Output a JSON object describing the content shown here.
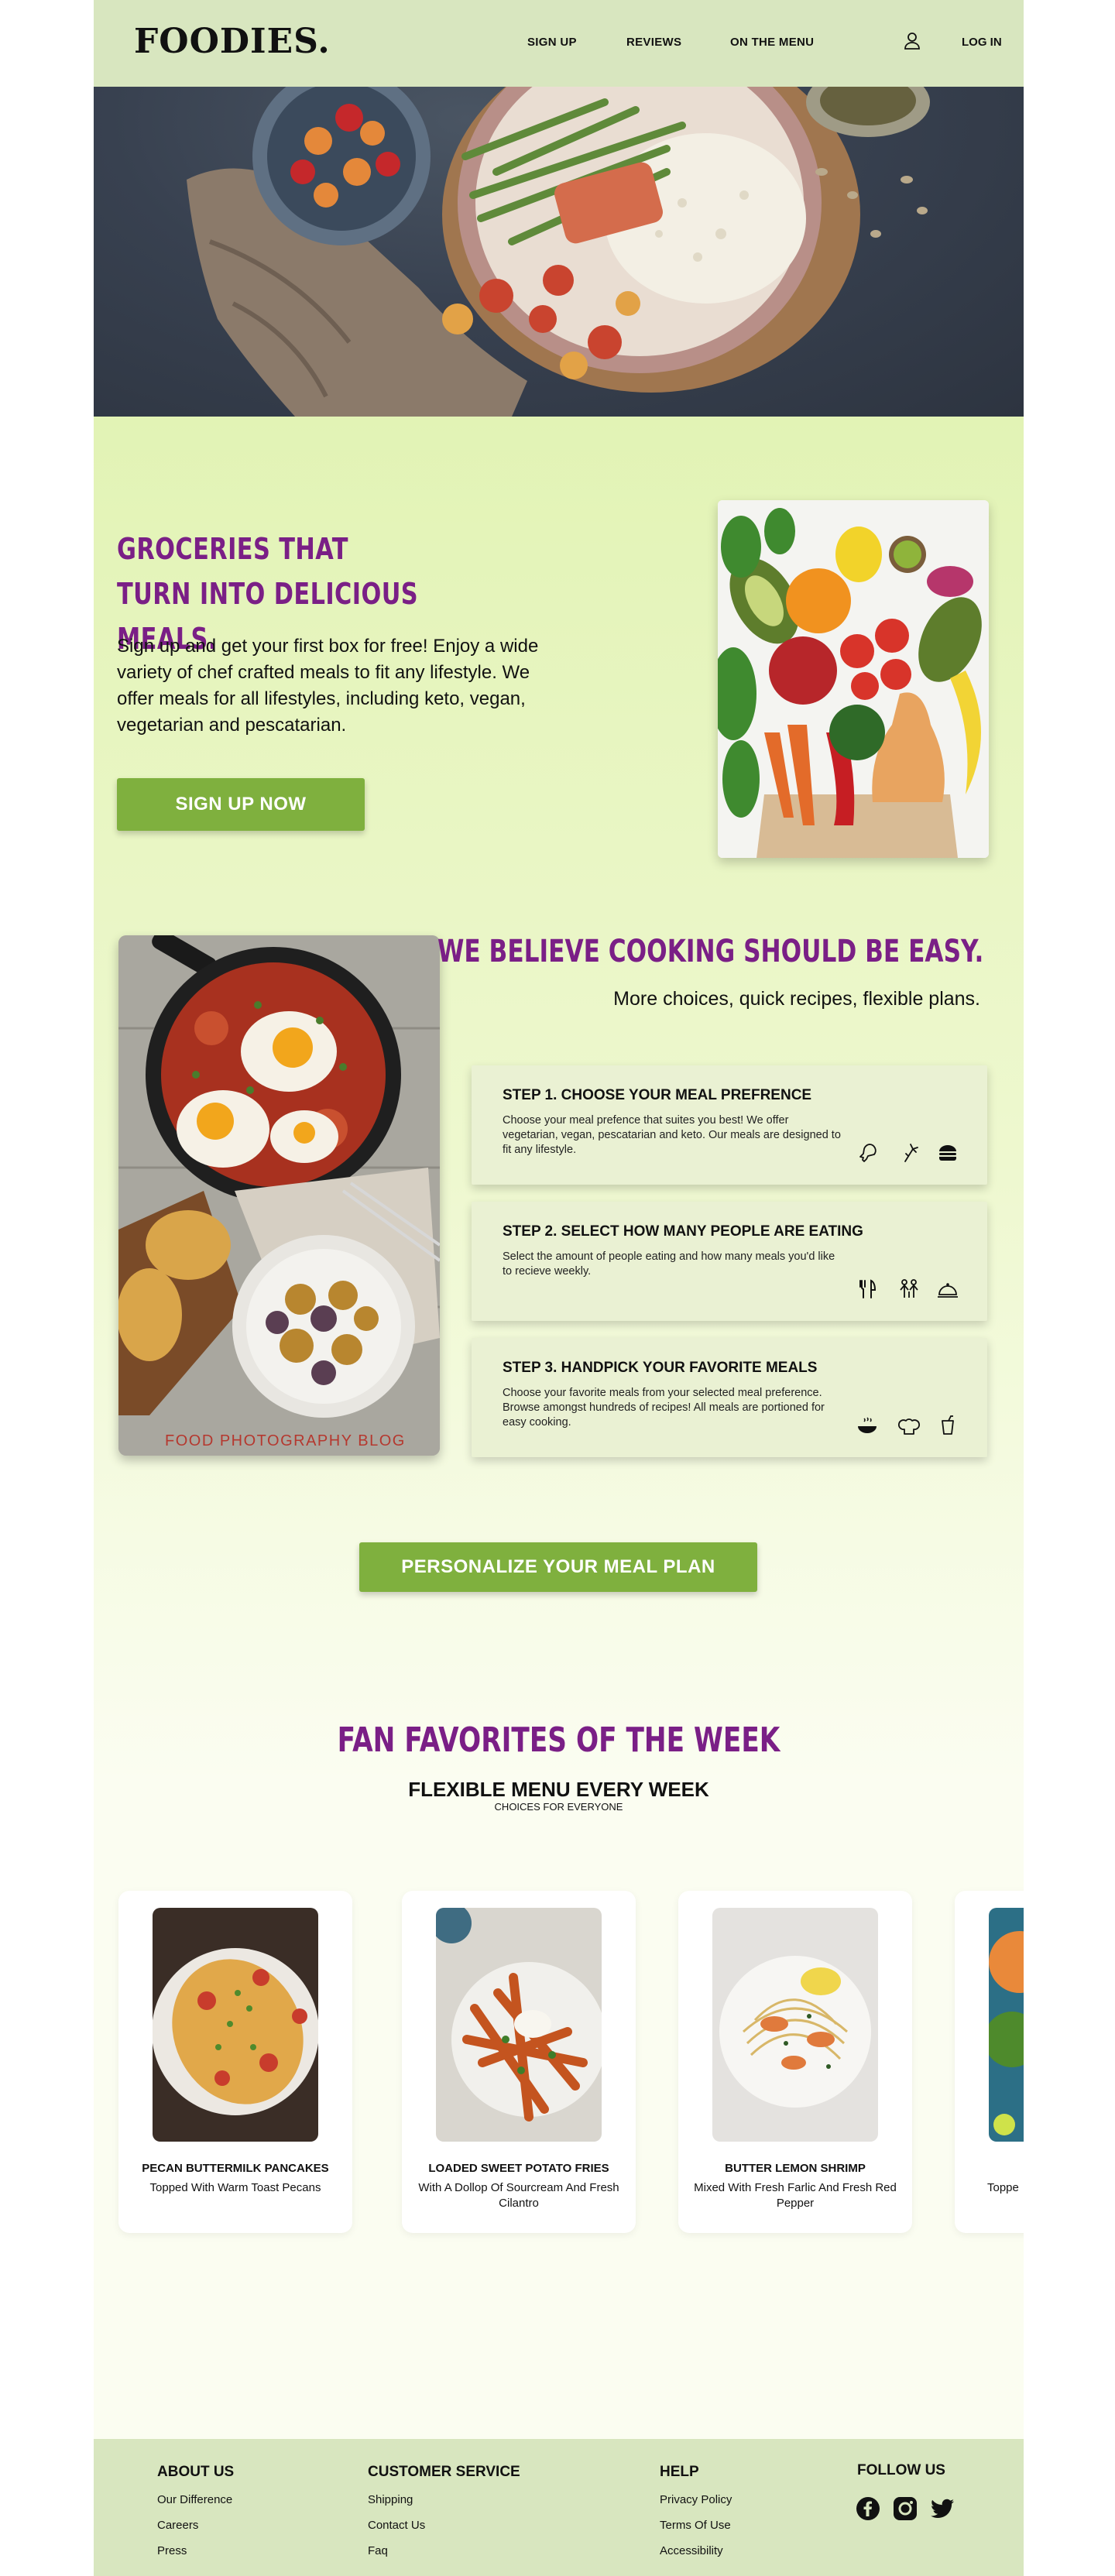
{
  "brand": {
    "logo": "FOODIES."
  },
  "nav": {
    "signup": "SIGN UP",
    "reviews": "REVIEWS",
    "menu": "ON THE MENU",
    "login": "LOG IN",
    "user_icon": "user-icon"
  },
  "colors": {
    "accent_purple": "#7a1f86",
    "button_green": "#7fb03e",
    "header_bg": "#d8e6bf",
    "page_bg": "#e2f3b5"
  },
  "intro": {
    "title": "GROCERIES THAT TURN INTO DELICIOUS MEALS.",
    "text": "Sign up and get your first box for free! Enjoy a wide variety of chef crafted meals to fit any lifestyle. We offer meals for all lifestyles, including keto, vegan, vegetarian and pescatarian.",
    "button": "SIGN UP NOW"
  },
  "cooking": {
    "title": "WE BELIEVE COOKING SHOULD BE EASY.",
    "subtitle": "More choices, quick recipes, flexible plans.",
    "photo_watermark": "FOOD PHOTOGRAPHY BLOG",
    "steps": [
      {
        "title": "STEP 1. CHOOSE YOUR MEAL PREFRENCE",
        "text": "Choose your meal prefence that suites you best! We offer vegetarian, vegan, pescatarian and keto. Our meals are designed to fit any lifestyle.",
        "icons": [
          "meat-drumstick-icon",
          "carrot-icon",
          "burger-icon"
        ]
      },
      {
        "title": "STEP 2. SELECT HOW MANY PEOPLE ARE EATING",
        "text": "Select the amount of people eating and how many meals you'd like to recieve weekly.",
        "icons": [
          "fork-knife-icon",
          "family-icon",
          "cloche-icon"
        ]
      },
      {
        "title": "STEP 3. HANDPICK YOUR FAVORITE MEALS",
        "text": "Choose your favorite meals from your selected meal preference. Browse amongst hundreds of recipes! All meals are portioned for easy cooking.",
        "icons": [
          "bowl-icon",
          "chef-hat-icon",
          "drink-icon"
        ]
      }
    ],
    "button": "PERSONALIZE YOUR MEAL PLAN"
  },
  "favorites": {
    "title": "FAN FAVORITES OF THE WEEK",
    "subtitle": "FLEXIBLE MENU EVERY WEEK",
    "subtitle2": "CHOICES FOR EVERYONE",
    "cards": [
      {
        "name": "PECAN BUTTERMILK PANCAKES",
        "desc": "Topped With Warm Toast Pecans"
      },
      {
        "name": "LOADED SWEET POTATO FRIES",
        "desc": "With A Dollop Of Sourcream And Fresh Cilantro"
      },
      {
        "name": "BUTTER LEMON SHRIMP",
        "desc": "Mixed With Fresh Farlic And Fresh Red Pepper"
      },
      {
        "name": "",
        "desc": "Toppe"
      }
    ]
  },
  "footer": {
    "about": {
      "title": "ABOUT US",
      "links": [
        "Our Difference",
        "Careers",
        "Press"
      ]
    },
    "service": {
      "title": "CUSTOMER SERVICE",
      "links": [
        "Shipping",
        "Contact Us",
        "Faq"
      ]
    },
    "help": {
      "title": "HELP",
      "links": [
        "Privacy Policy",
        "Terms Of Use",
        "Accessibility"
      ]
    },
    "follow": {
      "title": "FOLLOW US",
      "icons": [
        "facebook-icon",
        "instagram-icon",
        "twitter-icon"
      ]
    }
  }
}
